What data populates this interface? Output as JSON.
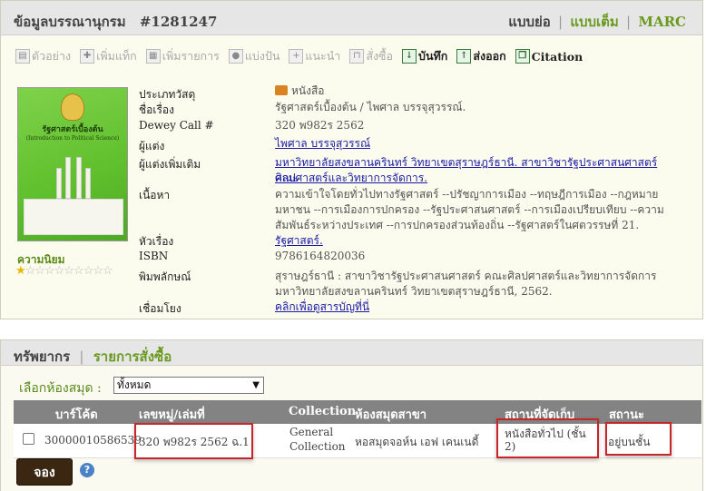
{
  "record": {
    "title_label": "ข้อมูลบรรณานุกรม",
    "record_number": "#1281247",
    "views": {
      "short": "แบบย่อ",
      "full": "แบบเต็ม",
      "marc": "MARC",
      "separator": "|"
    }
  },
  "toolbar": {
    "items": [
      {
        "label": "ตัวอย่าง",
        "icon": "preview-icon",
        "enabled": false
      },
      {
        "label": "เพิ่มแท็ก",
        "icon": "tag-icon",
        "enabled": false
      },
      {
        "label": "เพิ่มรายการ",
        "icon": "add-list-icon",
        "enabled": false
      },
      {
        "label": "แบ่งปัน",
        "icon": "share-users-icon",
        "enabled": false
      },
      {
        "label": "แนะนำ",
        "icon": "recommend-icon",
        "enabled": false
      },
      {
        "label": "สั่งซื้อ",
        "icon": "cart-icon",
        "enabled": false
      },
      {
        "label": "บันทึก",
        "icon": "save-icon",
        "enabled": true
      },
      {
        "label": "ส่งออก",
        "icon": "export-icon",
        "enabled": true
      },
      {
        "label": "Citation",
        "icon": "citation-icon",
        "enabled": true
      }
    ]
  },
  "cover": {
    "title": "รัฐศาสตร์เบื้องต้น",
    "subtitle": "(Introduction to Political Science)"
  },
  "popularity": {
    "label": "ความนิยม",
    "stars_filled": 1,
    "stars_total": 10
  },
  "metadata": {
    "type_label": "ประเภทวัสดุ",
    "type_value": "หนังสือ",
    "type_icon": "book-icon",
    "title_label": "ชื่อเรื่อง",
    "title_value": "รัฐศาสตร์เบื้องต้น / ไพศาล บรรจุสุวรรณ์.",
    "dewey_label": "Dewey Call #",
    "dewey_value": "320 พ982ร 2562",
    "author_label": "ผู้แต่ง",
    "author_value": "ไพศาล บรรจุสุวรรณ์",
    "added_author_label": "ผู้แต่งเพิ่มเติม",
    "added_author_line1": "มหาวิทยาลัยสงขลานครินทร์ วิทยาเขตสุราษฎร์ธานี. สาขาวิชารัฐประศาสนศาสตร์ คณะ",
    "added_author_line2": "ศิลปศาสตร์และวิทยาการจัดการ.",
    "contents_label": "เนื้อหา",
    "contents_line1": "ความเข้าใจโดยทั่วไปทางรัฐศาสตร์ --ปรัชญาการเมือง --ทฤษฎีการเมือง --กฎหมาย",
    "contents_line2": "มหาชน --การเมืองการปกครอง --รัฐประศาสนศาสตร์ --การเมืองเปรียบเทียบ --ความ",
    "contents_line3": "สัมพันธ์ระหว่างประเทศ --การปกครองส่วนท้องถิ่น --รัฐศาสตร์ในศตวรรษที่ 21.",
    "subject_label": "หัวเรื่อง",
    "subject_value": "รัฐศาสตร์.",
    "isbn_label": "ISBN",
    "isbn_value": "9786164820036",
    "publication_label": "พิมพลักษณ์",
    "publication_line1": "สุราษฎร์ธานี : สาขาวิชารัฐประศาสนศาสตร์ คณะศิลปศาสตร์และวิทยาการจัดการ",
    "publication_line2": "มหาวิทยาลัยสงขลานครินทร์ วิทยาเขตสุราษฎร์ธานี, 2562.",
    "link_label": "เชื่อมโยง",
    "link_value": "คลิกเพื่อดูสารบัญที่นี่"
  },
  "holdings": {
    "title": "ทรัพยากร",
    "separator": "|",
    "orders_link": "รายการสั่งซื้อ",
    "library_label": "เลือกห้องสมุด :",
    "library_selected": "ทั้งหมด",
    "columns": {
      "barcode": "บาร์โค้ด",
      "call_no": "เลขหมู่/เล่มที่",
      "collection": "Collection",
      "branch": "ห้องสมุดสาขา",
      "location": "สถานที่จัดเก็บ",
      "status": "สถานะ"
    },
    "rows": [
      {
        "barcode": "30000010586539",
        "call_no": "320 พ982ร 2562 ฉ.1",
        "collection_line1": "General",
        "collection_line2": "Collection",
        "branch": "หอสมุดจอห์น เอฟ เคนเนดี้",
        "location_line1": "หนังสือทั่วไป (ชั้น",
        "location_line2": "2)",
        "status": "อยู่บนชั้น"
      }
    ],
    "reserve_button": "จอง",
    "help_icon": "?"
  }
}
